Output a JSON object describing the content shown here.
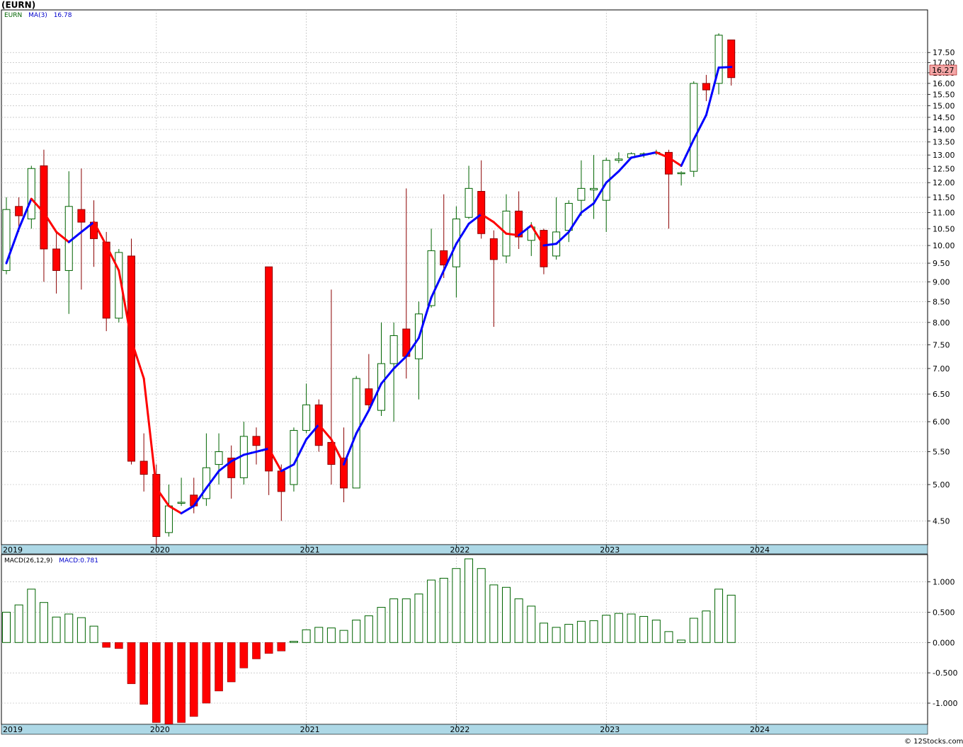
{
  "header": {
    "title": "(EURN)"
  },
  "price_legend": {
    "symbol": "EURN",
    "ma_label": "MA(3)",
    "ma_value": "16.78"
  },
  "macd_legend": {
    "label": "MACD(26,12,9)",
    "value_label": "MACD:0.781"
  },
  "last_price_label": "16.27",
  "footer": "© 12Stocks.com",
  "colors": {
    "up_fill": "#ffffff",
    "up_stroke": "#006400",
    "down_fill": "#ff0000",
    "down_stroke": "#8b0000",
    "ma_up": "#0000ff",
    "ma_down": "#ff0000",
    "macd_pos_stroke": "#006400",
    "macd_neg_fill": "#ff0000",
    "axis_band": "#add8e6",
    "grid": "#b0b0b0",
    "last_badge": "#f4a6a6"
  },
  "chart_data": [
    {
      "type": "candlestick",
      "name": "EURN",
      "y_scale": "log",
      "ylim": [
        4.2,
        19.8
      ],
      "y_ticks": [
        "4.50",
        "5.00",
        "5.50",
        "6.00",
        "6.50",
        "7.00",
        "7.50",
        "8.00",
        "8.50",
        "9.00",
        "9.50",
        "10.00",
        "10.50",
        "11.00",
        "11.50",
        "12.00",
        "12.50",
        "13.00",
        "13.50",
        "14.00",
        "14.50",
        "15.00",
        "15.50",
        "16.00",
        "16.50",
        "17.00",
        "17.50"
      ],
      "x_labels": [
        "2019",
        "2020",
        "2021",
        "2022",
        "2023",
        "2024"
      ],
      "x_label_positions": [
        6.6,
        9,
        21,
        33,
        45,
        57
      ],
      "months_x0": 0,
      "candles": [
        {
          "o": 9.3,
          "h": 11.5,
          "l": 9.2,
          "c": 11.1
        },
        {
          "o": 11.2,
          "h": 11.5,
          "l": 10.4,
          "c": 10.9
        },
        {
          "o": 10.8,
          "h": 12.6,
          "l": 10.5,
          "c": 12.5
        },
        {
          "o": 12.6,
          "h": 13.2,
          "l": 9.0,
          "c": 9.9
        },
        {
          "o": 9.9,
          "h": 10.4,
          "l": 8.7,
          "c": 9.3
        },
        {
          "o": 9.3,
          "h": 12.4,
          "l": 8.2,
          "c": 11.2
        },
        {
          "o": 11.1,
          "h": 12.5,
          "l": 8.8,
          "c": 10.7
        },
        {
          "o": 10.7,
          "h": 11.4,
          "l": 9.4,
          "c": 10.2
        },
        {
          "o": 10.1,
          "h": 10.4,
          "l": 7.8,
          "c": 8.1
        },
        {
          "o": 8.1,
          "h": 9.9,
          "l": 8.0,
          "c": 9.8
        },
        {
          "o": 9.7,
          "h": 10.2,
          "l": 5.3,
          "c": 5.35
        },
        {
          "o": 5.35,
          "h": 5.8,
          "l": 4.9,
          "c": 5.15
        },
        {
          "o": 5.15,
          "h": 5.3,
          "l": 4.2,
          "c": 4.3
        },
        {
          "o": 4.35,
          "h": 5.0,
          "l": 4.3,
          "c": 4.7
        },
        {
          "o": 4.75,
          "h": 5.1,
          "l": 4.7,
          "c": 4.75
        },
        {
          "o": 4.85,
          "h": 5.1,
          "l": 4.6,
          "c": 4.7
        },
        {
          "o": 4.8,
          "h": 5.8,
          "l": 4.7,
          "c": 5.25
        },
        {
          "o": 5.3,
          "h": 5.8,
          "l": 5.0,
          "c": 5.5
        },
        {
          "o": 5.4,
          "h": 5.6,
          "l": 4.8,
          "c": 5.1
        },
        {
          "o": 5.1,
          "h": 6.0,
          "l": 5.0,
          "c": 5.75
        },
        {
          "o": 5.75,
          "h": 5.9,
          "l": 5.3,
          "c": 5.6
        },
        {
          "o": 9.4,
          "h": 9.4,
          "l": 4.85,
          "c": 5.2
        },
        {
          "o": 5.2,
          "h": 5.3,
          "l": 4.5,
          "c": 4.9
        },
        {
          "o": 5.0,
          "h": 5.9,
          "l": 4.9,
          "c": 5.85
        },
        {
          "o": 5.85,
          "h": 6.7,
          "l": 5.8,
          "c": 6.3
        },
        {
          "o": 6.3,
          "h": 6.4,
          "l": 5.5,
          "c": 5.6
        },
        {
          "o": 5.65,
          "h": 8.8,
          "l": 5.0,
          "c": 5.3
        },
        {
          "o": 5.4,
          "h": 5.9,
          "l": 4.75,
          "c": 4.95
        },
        {
          "o": 4.95,
          "h": 6.85,
          "l": 4.95,
          "c": 6.8
        },
        {
          "o": 6.6,
          "h": 7.3,
          "l": 6.2,
          "c": 6.3
        },
        {
          "o": 6.2,
          "h": 8.0,
          "l": 6.1,
          "c": 7.1
        },
        {
          "o": 7.1,
          "h": 8.0,
          "l": 6.0,
          "c": 7.7
        },
        {
          "o": 7.85,
          "h": 11.8,
          "l": 6.8,
          "c": 7.25
        },
        {
          "o": 7.2,
          "h": 8.5,
          "l": 6.4,
          "c": 8.2
        },
        {
          "o": 8.4,
          "h": 10.5,
          "l": 8.35,
          "c": 9.85
        },
        {
          "o": 9.85,
          "h": 11.6,
          "l": 9.1,
          "c": 9.45
        },
        {
          "o": 9.4,
          "h": 11.2,
          "l": 8.6,
          "c": 10.8
        },
        {
          "o": 10.85,
          "h": 12.6,
          "l": 10.8,
          "c": 11.8
        },
        {
          "o": 11.7,
          "h": 12.8,
          "l": 10.2,
          "c": 10.35
        },
        {
          "o": 10.2,
          "h": 10.45,
          "l": 7.9,
          "c": 9.6
        },
        {
          "o": 9.7,
          "h": 11.6,
          "l": 9.5,
          "c": 11.05
        },
        {
          "o": 11.05,
          "h": 11.7,
          "l": 9.9,
          "c": 10.25
        },
        {
          "o": 10.15,
          "h": 10.7,
          "l": 9.7,
          "c": 10.55
        },
        {
          "o": 10.45,
          "h": 10.5,
          "l": 9.2,
          "c": 9.4
        },
        {
          "o": 9.7,
          "h": 11.5,
          "l": 9.6,
          "c": 10.4
        },
        {
          "o": 10.45,
          "h": 11.4,
          "l": 10.1,
          "c": 11.3
        },
        {
          "o": 11.4,
          "h": 12.8,
          "l": 10.9,
          "c": 11.8
        },
        {
          "o": 11.75,
          "h": 13.0,
          "l": 10.8,
          "c": 11.8
        },
        {
          "o": 11.4,
          "h": 12.9,
          "l": 10.4,
          "c": 12.8
        },
        {
          "o": 12.8,
          "h": 13.1,
          "l": 12.7,
          "c": 12.85
        },
        {
          "o": 12.9,
          "h": 13.1,
          "l": 12.85,
          "c": 13.05
        },
        {
          "o": 13.0,
          "h": 13.1,
          "l": 12.9,
          "c": 13.05
        },
        {
          "o": 13.1,
          "h": 13.2,
          "l": 13.0,
          "c": 13.1
        },
        {
          "o": 13.1,
          "h": 13.2,
          "l": 10.5,
          "c": 12.3
        },
        {
          "o": 12.35,
          "h": 12.4,
          "l": 11.9,
          "c": 12.35
        },
        {
          "o": 12.4,
          "h": 16.1,
          "l": 12.2,
          "c": 16.0
        },
        {
          "o": 16.0,
          "h": 16.4,
          "l": 15.2,
          "c": 15.7
        },
        {
          "o": 16.0,
          "h": 18.5,
          "l": 15.5,
          "c": 18.4
        },
        {
          "o": 18.15,
          "h": 18.15,
          "l": 15.9,
          "c": 16.27
        }
      ],
      "ma_series": [
        {
          "name": "MA(3)",
          "values": [
            9.5,
            10.5,
            11.45,
            11.0,
            10.4,
            10.1,
            10.4,
            10.7,
            10.0,
            9.3,
            7.6,
            6.8,
            4.95,
            4.7,
            4.6,
            4.7,
            4.95,
            5.2,
            5.35,
            5.45,
            5.5,
            5.55,
            5.2,
            5.3,
            5.7,
            5.95,
            5.7,
            5.3,
            5.8,
            6.2,
            6.7,
            7.0,
            7.25,
            7.65,
            8.6,
            9.3,
            10.05,
            10.65,
            10.95,
            10.7,
            10.35,
            10.3,
            10.6,
            10.0,
            10.05,
            10.4,
            11.0,
            11.3,
            12.0,
            12.4,
            12.9,
            13.0,
            13.1,
            12.9,
            12.6,
            13.6,
            14.6,
            16.75,
            16.78
          ]
        }
      ]
    },
    {
      "type": "bar",
      "name": "MACD(26,12,9)",
      "ylim": [
        -1.35,
        1.45
      ],
      "y_ticks": [
        "-1.000",
        "-0.500",
        "0.000",
        "0.500",
        "1.000"
      ],
      "x_labels": [
        "2019",
        "2020",
        "2021",
        "2022",
        "2023",
        "2024"
      ],
      "values": [
        0.5,
        0.62,
        0.88,
        0.66,
        0.42,
        0.47,
        0.41,
        0.27,
        -0.08,
        -0.1,
        -0.68,
        -1.02,
        -1.32,
        -1.35,
        -1.32,
        -1.22,
        -1.0,
        -0.8,
        -0.65,
        -0.42,
        -0.27,
        -0.18,
        -0.14,
        0.02,
        0.21,
        0.25,
        0.24,
        0.2,
        0.37,
        0.44,
        0.58,
        0.72,
        0.72,
        0.8,
        1.03,
        1.06,
        1.22,
        1.38,
        1.22,
        0.95,
        0.91,
        0.72,
        0.6,
        0.32,
        0.25,
        0.3,
        0.35,
        0.36,
        0.45,
        0.48,
        0.47,
        0.43,
        0.37,
        0.18,
        0.04,
        0.4,
        0.52,
        0.88,
        0.781
      ]
    }
  ]
}
